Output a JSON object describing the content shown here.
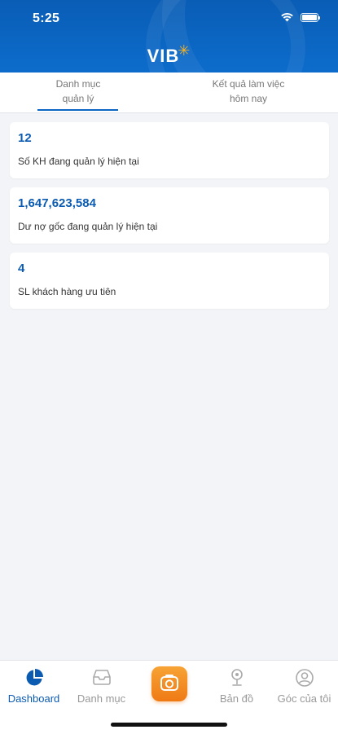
{
  "status_bar": {
    "time": "5:25"
  },
  "header": {
    "logo_text": "VIB",
    "brand_color": "#0b66c3",
    "accent_color": "#f4b223"
  },
  "tabs": [
    {
      "line1": "Danh mục",
      "line2": "quản lý",
      "active": true
    },
    {
      "line1": "Kết quả làm việc",
      "line2": "hôm nay",
      "active": false
    }
  ],
  "cards": [
    {
      "value": "12",
      "label": "Số KH đang quản lý hiện tại"
    },
    {
      "value": "1,647,623,584",
      "label": "Dư nợ gốc đang quản lý hiện tại"
    },
    {
      "value": "4",
      "label": "SL khách hàng ưu tiên"
    }
  ],
  "bottom_nav": [
    {
      "label": "Dashboard",
      "icon": "pie-chart-icon",
      "active": true
    },
    {
      "label": "Danh mục",
      "icon": "tray-icon",
      "active": false
    },
    {
      "label": "",
      "icon": "camera-icon",
      "active": false
    },
    {
      "label": "Bản đồ",
      "icon": "map-pin-icon",
      "active": false
    },
    {
      "label": "Góc của tôi",
      "icon": "user-icon",
      "active": false
    }
  ]
}
